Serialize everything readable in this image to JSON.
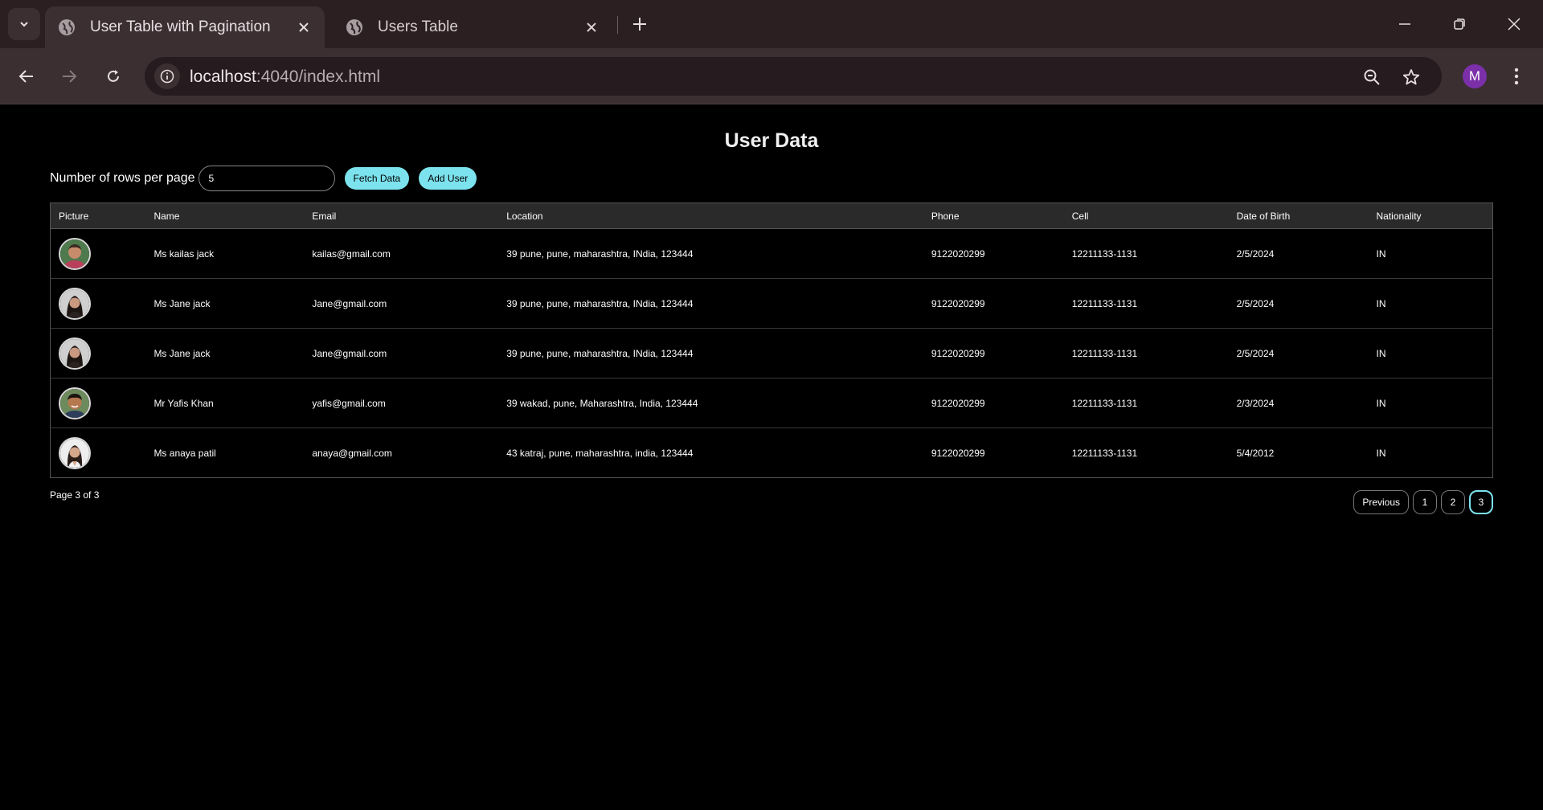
{
  "browser": {
    "tabs": [
      {
        "title": "User Table with Pagination",
        "active": true
      },
      {
        "title": "Users Table",
        "active": false
      }
    ],
    "url_host": "localhost",
    "url_rest": ":4040/index.html",
    "profile_initial": "M"
  },
  "page": {
    "title": "User Data",
    "rows_label": "Number of rows per page",
    "rows_value": "5",
    "fetch_label": "Fetch Data",
    "add_label": "Add User",
    "columns": [
      "Picture",
      "Name",
      "Email",
      "Location",
      "Phone",
      "Cell",
      "Date of Birth",
      "Nationality"
    ],
    "rows": [
      {
        "avatar": "man-red-shirt",
        "name": "Ms kailas jack",
        "email": "kailas@gmail.com",
        "location": "39 pune, pune, maharashtra, INdia, 123444",
        "phone": "9122020299",
        "cell": "12211133-1131",
        "dob": "2/5/2024",
        "nat": "IN"
      },
      {
        "avatar": "woman-dark-hair",
        "name": "Ms Jane jack",
        "email": "Jane@gmail.com",
        "location": "39 pune, pune, maharashtra, INdia, 123444",
        "phone": "9122020299",
        "cell": "12211133-1131",
        "dob": "2/5/2024",
        "nat": "IN"
      },
      {
        "avatar": "woman-dark-hair",
        "name": "Ms Jane jack",
        "email": "Jane@gmail.com",
        "location": "39 pune, pune, maharashtra, INdia, 123444",
        "phone": "9122020299",
        "cell": "12211133-1131",
        "dob": "2/5/2024",
        "nat": "IN"
      },
      {
        "avatar": "man-smiling",
        "name": "Mr Yafis Khan",
        "email": "yafis@gmail.com",
        "location": "39 wakad, pune, Maharashtra, India, 123444",
        "phone": "9122020299",
        "cell": "12211133-1131",
        "dob": "2/3/2024",
        "nat": "IN"
      },
      {
        "avatar": "woman-light-bg",
        "name": "Ms anaya patil",
        "email": "anaya@gmail.com",
        "location": "43 katraj, pune, maharashtra, india, 123444",
        "phone": "9122020299",
        "cell": "12211133-1131",
        "dob": "5/4/2012",
        "nat": "IN"
      }
    ],
    "page_info": "Page 3 of 3",
    "pager": {
      "previous": "Previous",
      "pages": [
        "1",
        "2",
        "3"
      ],
      "current": "3"
    }
  },
  "colors": {
    "accent": "#7ce3ee",
    "chrome": "#3b2f32",
    "tabbar": "#2b1f22"
  }
}
